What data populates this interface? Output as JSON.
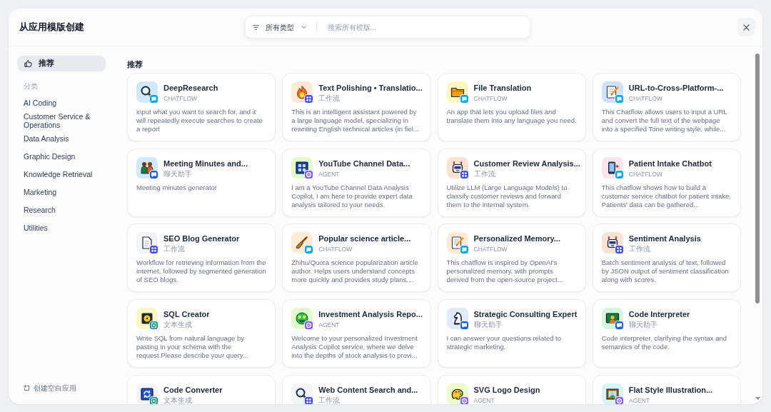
{
  "dialog": {
    "title": "从应用模版创建",
    "type_filter": "所有类型",
    "search": {
      "placeholder": "搜索所有模版..."
    }
  },
  "sidebar": {
    "recommended": {
      "label": "推荐",
      "selected": true
    },
    "category_heading": "分类",
    "categories": [
      {
        "label": "AI Coding",
        "selected": false
      },
      {
        "label": "Customer Service & Operations",
        "selected": false
      },
      {
        "label": "Data Analysis",
        "selected": false
      },
      {
        "label": "Graphic Design",
        "selected": false
      },
      {
        "label": "Knowledge Retrieval",
        "selected": false
      },
      {
        "label": "Marketing",
        "selected": false
      },
      {
        "label": "Research",
        "selected": false
      },
      {
        "label": "Utilities",
        "selected": false
      }
    ],
    "create_blank": "创建空白应用"
  },
  "main": {
    "section_title": "推荐",
    "templates": [
      {
        "name": "DeepResearch",
        "kind": "chatflow",
        "type_label": "CHATFLOW",
        "color": "#d1e9ff",
        "description": "input what you want to search for, and it will repeatedly execute searches to create a report"
      },
      {
        "name": "Text Polishing • Translatio...",
        "kind": "workflow",
        "type_label": "工作流",
        "color": "#ffead5",
        "description": "This is an intelligent assistant powered by a large language model, specializing in rewriting English technical articles (in fiel..."
      },
      {
        "name": "File Translation",
        "kind": "chatflow",
        "type_label": "CHATFLOW",
        "color": "#fef7c3",
        "description": "An app that lets you upload files and translate them into any language you need."
      },
      {
        "name": "URL-to-Cross-Platform-...",
        "kind": "chatflow",
        "type_label": "CHATFLOW",
        "color": "#d1e0ff",
        "description": "This Chatflow allows users to input a URL and convert the full text of the webpage into a specified Tone writing style, while..."
      },
      {
        "name": "Meeting Minutes and...",
        "kind": "chat",
        "type_label": "聊天助手",
        "color": "#d1e9ff",
        "description": "Meeting minutes generator"
      },
      {
        "name": "YouTube Channel Data...",
        "kind": "agent",
        "type_label": "AGENT",
        "color": "#e3fbcc",
        "description": "I am a YouTube Channel Data Analysis Copilot, I am here to provide expert data analysis tailored to your needs."
      },
      {
        "name": "Customer Review Analysis...",
        "kind": "workflow",
        "type_label": "工作流",
        "color": "#fbe3d3",
        "description": "Utilize LLM (Large Language Models) to classify customer reviews and forward them to the internal system."
      },
      {
        "name": "Patient Intake Chatbot",
        "kind": "chatflow",
        "type_label": "CHATFLOW",
        "color": "#fce4ec",
        "description": "This chatflow shows how to build a customer service chatbot for patient intake. Patients' data can be gathered..."
      },
      {
        "name": "SEO Blog Generator",
        "kind": "workflow",
        "type_label": "工作流",
        "color": "#f2f4f7",
        "description": "Workflow for retrieving information from the internet, followed by segmented generation of SEO blogs."
      },
      {
        "name": "Popular science article...",
        "kind": "chatflow",
        "type_label": "CHATFLOW",
        "color": "#ffead5",
        "description": "Zhihu/Quora science popularization article author. Helps users understand concepts more quickly and provides study plans...."
      },
      {
        "name": "Personalized Memory...",
        "kind": "chatflow",
        "type_label": "CHATFLOW",
        "color": "#ffead5",
        "description": "This chatflow is inspired by OpenAI's personalized memory, with prompts derived from the open-source project..."
      },
      {
        "name": "Sentiment Analysis",
        "kind": "workflow",
        "type_label": "工作流",
        "color": "#fbe3d3",
        "description": "Batch sentiment analysis of text, followed by JSON output of sentiment classification along with scores."
      },
      {
        "name": "SQL Creator",
        "kind": "completion",
        "type_label": "文本生成",
        "color": "#fef7c3",
        "description": "Write SQL from natural language by pasting in your schema with the request.Please describe your query..."
      },
      {
        "name": "Investment Analysis Repo...",
        "kind": "agent",
        "type_label": "AGENT",
        "color": "#e3fbcc",
        "description": "Welcome to your personalized Investment Analysis Copilot service, where we delve into the depths of stock analysis to provi..."
      },
      {
        "name": "Strategic Consulting Expert",
        "kind": "chat",
        "type_label": "聊天助手",
        "color": "#e0eaff",
        "description": "I can answer your questions related to strategic marketing."
      },
      {
        "name": "Code Interpreter",
        "kind": "chat",
        "type_label": "聊天助手",
        "color": "#d3f8df",
        "description": "Code interpreter, clarifying the syntax and semantics of the code."
      },
      {
        "name": "Code Converter",
        "kind": "completion",
        "type_label": "文本生成",
        "color": "#f2f4f7"
      },
      {
        "name": "Web Content Search and...",
        "kind": "workflow",
        "type_label": "工作流",
        "color": "#f2f4f7"
      },
      {
        "name": "SVG Logo Design",
        "kind": "agent",
        "type_label": "AGENT",
        "color": "#ecfccb"
      },
      {
        "name": "Flat Style Illustration...",
        "kind": "agent",
        "type_label": "AGENT",
        "color": "#d5f5f6"
      }
    ]
  }
}
